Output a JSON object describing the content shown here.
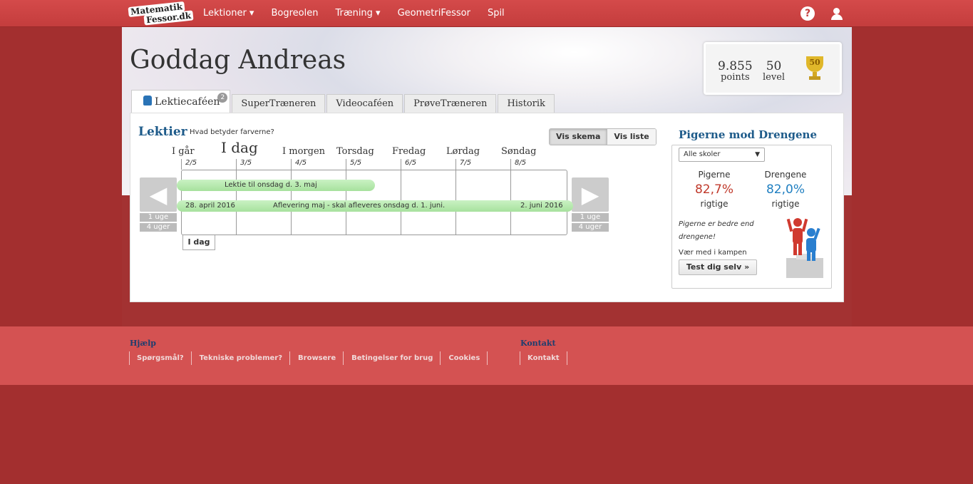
{
  "logo": {
    "line1": "Matematik",
    "line2": "Fessor.dk"
  },
  "nav": {
    "items": [
      "Lektioner ▾",
      "Bogreolen",
      "Træning ▾",
      "GeometriFessor",
      "Spil"
    ],
    "help_icon": "?"
  },
  "greeting": "Goddag Andreas",
  "stats": {
    "points_value": "9.855",
    "points_label": "points",
    "level_value": "50",
    "level_label": "level",
    "trophy_level": "50"
  },
  "tabs": {
    "active_label": "Lektiecaféen",
    "active_badge": "2",
    "others": [
      "SuperTræneren",
      "Videocaféen",
      "PrøveTræneren",
      "Historik"
    ]
  },
  "lektier": {
    "title": "Lektier",
    "help": "Hvad betyder farverne?",
    "view_schema": "Vis skema",
    "view_list": "Vis liste",
    "days": [
      {
        "name": "I går",
        "date": "2/5"
      },
      {
        "name": "I dag",
        "date": "3/5"
      },
      {
        "name": "I morgen",
        "date": "4/5"
      },
      {
        "name": "Torsdag",
        "date": "5/5"
      },
      {
        "name": "Fredag",
        "date": "6/5"
      },
      {
        "name": "Lørdag",
        "date": "7/5"
      },
      {
        "name": "Søndag",
        "date": "8/5"
      }
    ],
    "prev_arrow": "◀",
    "next_arrow": "▶",
    "week_btn": "1 uge",
    "month_btn": "4 uger",
    "bar1": "Lektie til onsdag d. 3. maj",
    "bar2": {
      "start": "28. april 2016",
      "text": "Aflevering maj - skal afleveres onsdag d. 1. juni.",
      "end": "2. juni 2016"
    },
    "today_btn": "I dag"
  },
  "pmd": {
    "title": "Pigerne mod Drengene",
    "select": "Alle skoler",
    "girls": {
      "name": "Pigerne",
      "pct": "82,7%",
      "label": "rigtige",
      "color": "#c0392b"
    },
    "boys": {
      "name": "Drengene",
      "pct": "82,0%",
      "label": "rigtige",
      "color": "#1f7fc1"
    },
    "note": "Pigerne er bedre end drengene!",
    "join": "Vær med i kampen",
    "test_btn": "Test dig selv »"
  },
  "footer": {
    "help_heading": "Hjælp",
    "help_links": [
      "Spørgsmål?",
      "Tekniske problemer?",
      "Browsere",
      "Betingelser for brug",
      "Cookies"
    ],
    "contact_heading": "Kontakt",
    "contact_links": [
      "Kontakt"
    ]
  }
}
